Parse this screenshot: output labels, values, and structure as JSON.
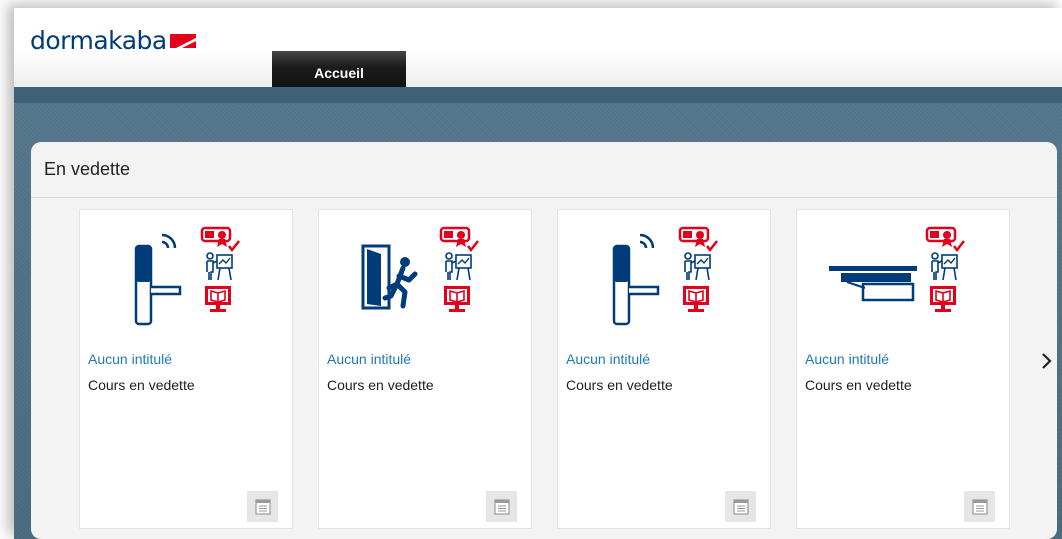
{
  "brand": {
    "logo_text": "dormakaba",
    "primary_color": "#003b7a",
    "accent_color": "#e2001a"
  },
  "nav": {
    "tabs": [
      {
        "label": "Accueil",
        "active": true
      }
    ]
  },
  "featured": {
    "title": "En vedette",
    "next_icon": "chevron-right-icon",
    "cards": [
      {
        "title": "Aucun intitulé",
        "subtitle": "Cours en vedette",
        "image": "door-lock-training-icon",
        "action_icon": "details-icon"
      },
      {
        "title": "Aucun intitulé",
        "subtitle": "Cours en vedette",
        "image": "emergency-exit-training-icon",
        "action_icon": "details-icon"
      },
      {
        "title": "Aucun intitulé",
        "subtitle": "Cours en vedette",
        "image": "door-lock-training-icon",
        "action_icon": "details-icon"
      },
      {
        "title": "Aucun intitulé",
        "subtitle": "Cours en vedette",
        "image": "door-closer-training-icon",
        "action_icon": "details-icon"
      }
    ]
  }
}
